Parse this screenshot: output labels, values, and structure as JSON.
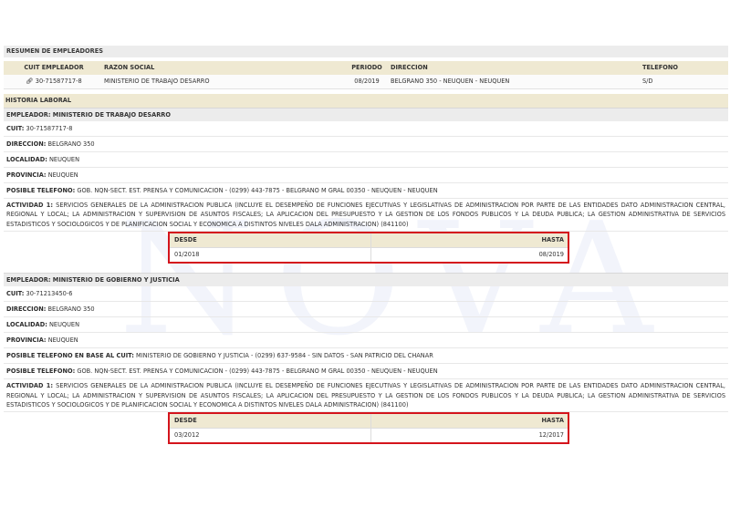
{
  "watermark": "NOVA",
  "summary": {
    "title": "RESUMEN DE EMPLEADORES",
    "headers": {
      "cuit": "CUIT EMPLEADOR",
      "razon": "RAZON SOCIAL",
      "periodo": "PERIODO",
      "direccion": "DIRECCION",
      "telefono": "TELEFONO"
    },
    "row": {
      "cuit": "30-71587717-8",
      "razon": "MINISTERIO DE TRABAJO DESARRO",
      "periodo": "08/2019",
      "direccion": "BELGRANO 350 - NEUQUEN - NEUQUEN",
      "telefono": "S/D"
    }
  },
  "history_title": "HISTORIA LABORAL",
  "employers": [
    {
      "header": "EMPLEADOR: MINISTERIO DE TRABAJO DESARRO",
      "cuit_label": "CUIT:",
      "cuit": "30-71587717-8",
      "dir_label": "DIRECCION:",
      "dir": "BELGRANO 350",
      "loc_label": "LOCALIDAD:",
      "loc": "NEUQUEN",
      "prov_label": "PROVINCIA:",
      "prov": "NEUQUEN",
      "tel_label": "POSIBLE TELEFONO:",
      "tel": "GOB. NQN-SECT. EST. PRENSA Y COMUNICACION - (0299) 443-7875 - BELGRANO M GRAL 00350 - NEUQUEN - NEUQUEN",
      "act_label": "ACTIVIDAD 1:",
      "act": "SERVICIOS GENERALES DE LA ADMINISTRACION PUBLICA (INCLUYE EL DESEMPEÑO DE FUNCIONES EJECUTIVAS Y LEGISLATIVAS DE ADMINISTRACION POR PARTE DE LAS ENTIDADES DATO ADMINISTRACION CENTRAL, REGIONAL Y LOCAL; LA ADMINISTRACION Y SUPERVISION DE ASUNTOS FISCALES; LA APLICACION DEL PRESUPUESTO Y LA GESTION DE LOS FONDOS PUBLICOS Y LA DEUDA PUBLICA; LA GESTION ADMINISTRATIVA DE SERVICIOS ESTADISTICOS Y SOCIOLOGICOS Y DE PLANIFICACION SOCIAL Y ECONOMICA A DISTINTOS NIVELES DALA ADMINISTRACION) (841100)",
      "desde_label": "DESDE",
      "hasta_label": "HASTA",
      "desde": "01/2018",
      "hasta": "08/2019"
    },
    {
      "header": "EMPLEADOR: MINISTERIO DE GOBIERNO Y JUSTICIA",
      "cuit_label": "CUIT:",
      "cuit": "30-71213450-6",
      "dir_label": "DIRECCION:",
      "dir": "BELGRANO 350",
      "loc_label": "LOCALIDAD:",
      "loc": "NEUQUEN",
      "prov_label": "PROVINCIA:",
      "prov": "NEUQUEN",
      "tel_cuit_label": "POSIBLE TELEFONO EN BASE AL CUIT:",
      "tel_cuit": "MINISTERIO DE GOBIERNO Y JUSTICIA - (0299) 637-9584 - SIN DATOS - SAN PATRICIO DEL CHANAR",
      "tel_label": "POSIBLE TELEFONO:",
      "tel": "GOB. NQN-SECT. EST. PRENSA Y COMUNICACION - (0299) 443-7875 - BELGRANO M GRAL 00350 - NEUQUEN - NEUQUEN",
      "act_label": "ACTIVIDAD 1:",
      "act": "SERVICIOS GENERALES DE LA ADMINISTRACION PUBLICA (INCLUYE EL DESEMPEÑO DE FUNCIONES EJECUTIVAS Y LEGISLATIVAS DE ADMINISTRACION POR PARTE DE LAS ENTIDADES DATO ADMINISTRACION CENTRAL, REGIONAL Y LOCAL; LA ADMINISTRACION Y SUPERVISION DE ASUNTOS FISCALES; LA APLICACION DEL PRESUPUESTO Y LA GESTION DE LOS FONDOS PUBLICOS Y LA DEUDA PUBLICA; LA GESTION ADMINISTRATIVA DE SERVICIOS ESTADISTICOS Y SOCIOLOGICOS Y DE PLANIFICACION SOCIAL Y ECONOMICA A DISTINTOS NIVELES DALA ADMINISTRACION) (841100)",
      "desde_label": "DESDE",
      "hasta_label": "HASTA",
      "desde": "03/2012",
      "hasta": "12/2017"
    }
  ],
  "colors": {
    "highlight_box": "#d4141c",
    "header_band": "#efe9d2"
  }
}
